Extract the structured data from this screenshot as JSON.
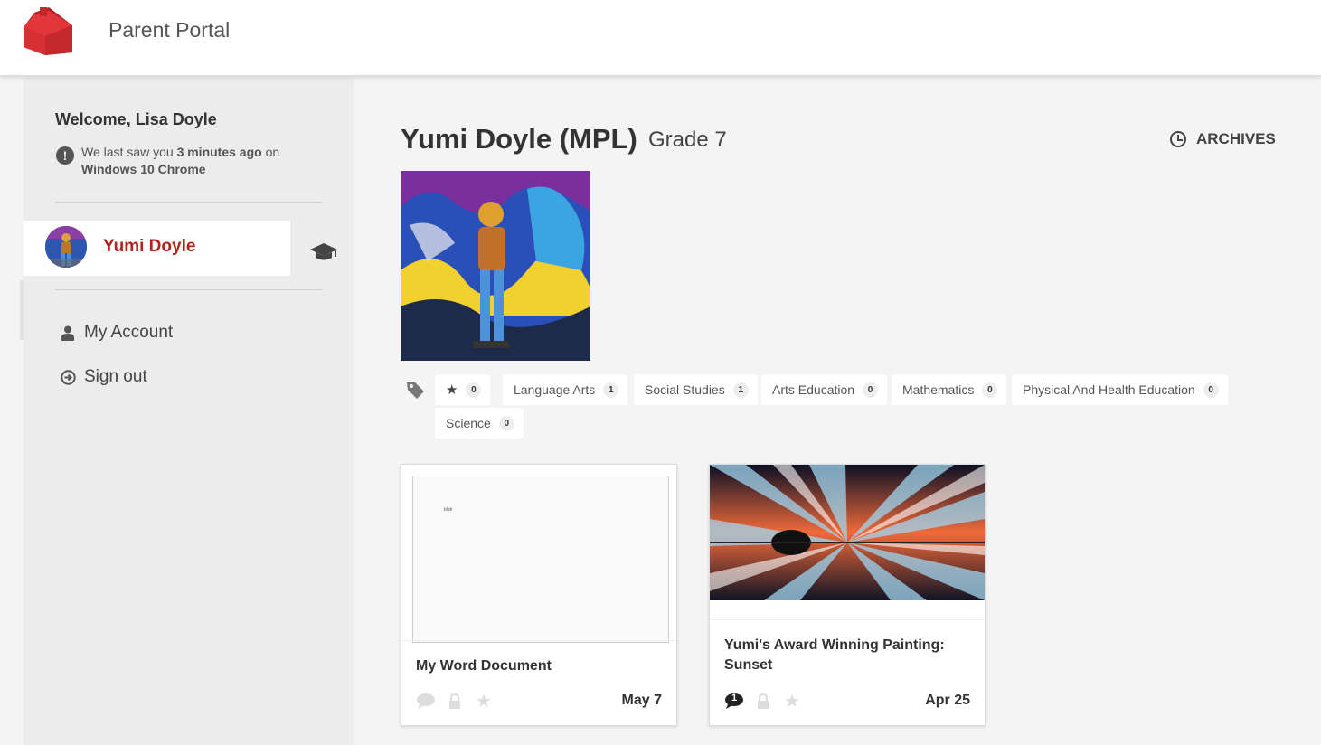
{
  "header": {
    "app_title": "Parent Portal",
    "logo_icon": "schoolhouse-icon",
    "brand_color": "#d0262a"
  },
  "sidebar": {
    "welcome": "Welcome, Lisa Doyle",
    "last_seen": {
      "prefix": "We last saw you",
      "when": "3 minutes ago",
      "on": "on",
      "device": "Windows 10 Chrome"
    },
    "student": {
      "name": "Yumi Doyle",
      "icon": "graduation-cap-icon"
    },
    "nav": [
      {
        "label": "My Account",
        "icon": "user-icon"
      },
      {
        "label": "Sign out",
        "icon": "sign-out-icon"
      }
    ]
  },
  "main": {
    "student_title": "Yumi Doyle (MPL)",
    "grade": "Grade 7",
    "archives_label": "ARCHIVES",
    "tags": [
      {
        "label": "",
        "icon": "star-icon",
        "count": "0"
      },
      {
        "label": "Language Arts",
        "count": "1"
      },
      {
        "label": "Social Studies",
        "count": "1"
      },
      {
        "label": "Arts Education",
        "count": "0"
      },
      {
        "label": "Mathematics",
        "count": "0"
      },
      {
        "label": "Physical And Health Education",
        "count": "0"
      },
      {
        "label": "Science",
        "count": "0"
      }
    ],
    "posts": [
      {
        "title": "My Word Document",
        "date": "May 7",
        "preview_text": "blah",
        "comments": ""
      },
      {
        "title": "Yumi's Award Winning Painting: Sunset",
        "date": "Apr 25",
        "comments": "1"
      }
    ]
  }
}
